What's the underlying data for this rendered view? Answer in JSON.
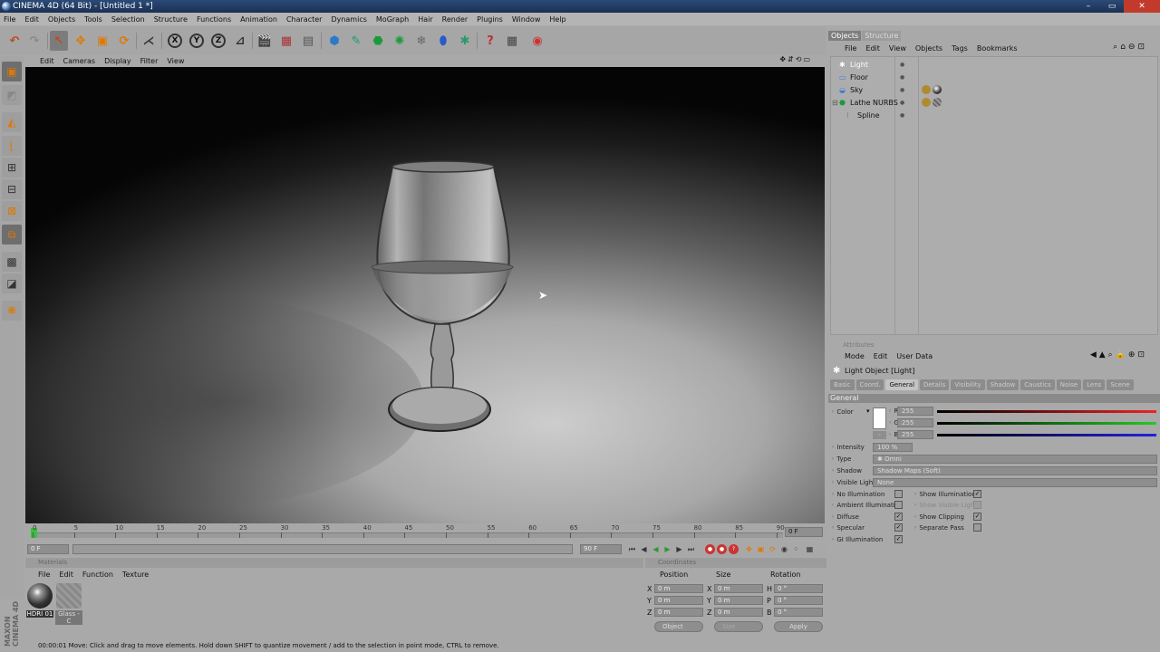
{
  "window": {
    "title": "CINEMA 4D (64 Bit) - [Untitled 1 *]"
  },
  "menubar": [
    "File",
    "Edit",
    "Objects",
    "Tools",
    "Selection",
    "Structure",
    "Functions",
    "Animation",
    "Character",
    "Dynamics",
    "MoGraph",
    "Hair",
    "Render",
    "Plugins",
    "Window",
    "Help"
  ],
  "viewport": {
    "menu": [
      "Edit",
      "Cameras",
      "Display",
      "Filter",
      "View"
    ]
  },
  "timeline": {
    "ticks": [
      "0",
      "5",
      "10",
      "15",
      "20",
      "25",
      "30",
      "35",
      "40",
      "45",
      "50",
      "55",
      "60",
      "65",
      "70",
      "75",
      "80",
      "85",
      "90"
    ],
    "end_frame": "0 F",
    "current_frame": "0 F",
    "max_frame": "90 F"
  },
  "materials": {
    "title": "Materials",
    "menu": [
      "File",
      "Edit",
      "Function",
      "Texture"
    ],
    "items": [
      {
        "name": "HDRI 01"
      },
      {
        "name": "Glass - C"
      }
    ]
  },
  "coordinates": {
    "title": "Coordinates",
    "headers": [
      "Position",
      "Size",
      "Rotation"
    ],
    "rows": [
      {
        "axis": "X",
        "pos": "0 m",
        "size_axis": "X",
        "size": "0 m",
        "rot_axis": "H",
        "rot": "0 °"
      },
      {
        "axis": "Y",
        "pos": "0 m",
        "size_axis": "Y",
        "size": "0 m",
        "rot_axis": "P",
        "rot": "0 °"
      },
      {
        "axis": "Z",
        "pos": "0 m",
        "size_axis": "Z",
        "size": "0 m",
        "rot_axis": "B",
        "rot": "0 °"
      }
    ],
    "mode": "Object",
    "size_mode": "Size",
    "apply": "Apply"
  },
  "status": "00:00:01   Move: Click and drag to move elements. Hold down SHIFT to quantize movement / add to the selection in point mode, CTRL to remove.",
  "brand": [
    "MAXON",
    "CINEMA 4D"
  ],
  "objects_manager": {
    "tabs": [
      "Objects",
      "Structure"
    ],
    "menu": [
      "File",
      "Edit",
      "View",
      "Objects",
      "Tags",
      "Bookmarks"
    ],
    "items": [
      {
        "name": "Light",
        "icon": "light-icon",
        "selected": true
      },
      {
        "name": "Floor",
        "icon": "floor-icon"
      },
      {
        "name": "Sky",
        "icon": "sky-icon"
      },
      {
        "name": "Lathe NURBS",
        "icon": "lathe-nurbs-icon"
      },
      {
        "name": "Spline",
        "icon": "spline-icon"
      }
    ]
  },
  "attributes": {
    "title": "Attributes",
    "menu": [
      "Mode",
      "Edit",
      "User Data"
    ],
    "object_label": "Light Object [Light]",
    "tabs": [
      {
        "label": "Basic"
      },
      {
        "label": "Coord."
      },
      {
        "label": "General",
        "active": true
      },
      {
        "label": "Details"
      },
      {
        "label": "Visibility"
      },
      {
        "label": "Shadow"
      },
      {
        "label": "Caustics"
      },
      {
        "label": "Noise"
      },
      {
        "label": "Lens"
      },
      {
        "label": "Scene"
      }
    ],
    "section": "General",
    "color": {
      "label": "Color",
      "r_label": "R",
      "g_label": "G",
      "b_label": "B",
      "r": "255",
      "g": "255",
      "b": "255",
      "swatch": "#ffffff"
    },
    "intensity": {
      "label": "Intensity",
      "value": "100 %"
    },
    "type": {
      "label": "Type",
      "value": "Omni"
    },
    "shadow": {
      "label": "Shadow",
      "value": "Shadow Maps (Soft)"
    },
    "visible_light": {
      "label": "Visible Light",
      "value": "None"
    },
    "checks_left": [
      {
        "label": "No Illumination",
        "checked": false
      },
      {
        "label": "Ambient Illumination",
        "checked": false
      },
      {
        "label": "Diffuse",
        "checked": true
      },
      {
        "label": "Specular",
        "checked": true
      },
      {
        "label": "GI Illumination",
        "checked": true
      }
    ],
    "checks_right": [
      {
        "label": "Show Illumination",
        "checked": true
      },
      {
        "label": "Show Visible Light",
        "checked": false
      },
      {
        "label": "Show Clipping",
        "checked": true
      },
      {
        "label": "Separate Pass",
        "checked": false
      }
    ]
  }
}
